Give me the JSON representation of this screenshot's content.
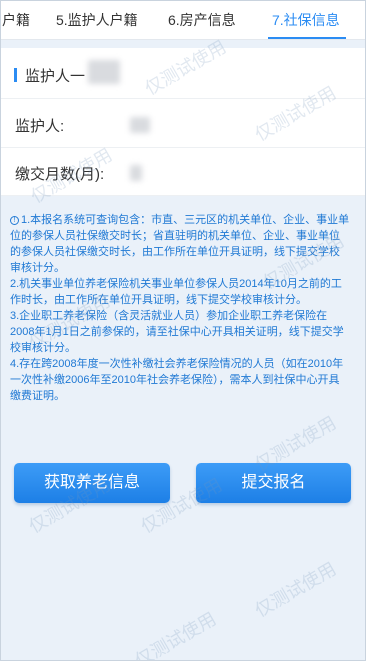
{
  "tabs": [
    {
      "label": "户籍"
    },
    {
      "label": "5.监护人户籍"
    },
    {
      "label": "6.房产信息"
    },
    {
      "label": "7.社保信息",
      "active": true
    }
  ],
  "section": {
    "title": "监护人一"
  },
  "fields": [
    {
      "label": "监护人:"
    },
    {
      "label": "缴交月数(月):"
    }
  ],
  "notice": {
    "icon": "info-icon",
    "paragraphs": [
      "1.本报名系统可查询包含：市直、三元区的机关单位、企业、事业单位的参保人员社保缴交时长；省直驻明的机关单位、企业、事业单位的参保人员社保缴交时长，由工作所在单位开具证明，线下提交学校审核计分。",
      "2.机关事业单位养老保险机关事业单位参保人员2014年10月之前的工作时长，由工作所在单位开具证明，线下提交学校审核计分。",
      "3.企业职工养老保险（含灵活就业人员）参加企业职工养老保险在2008年1月1日之前参保的，请至社保中心开具相关证明，线下提交学校审核计分。",
      "4.存在跨2008年度一次性补缴社会养老保险情况的人员（如在2010年一次性补缴2006年至2010年社会养老保险），需本人到社保中心开具缴费证明。"
    ]
  },
  "buttons": {
    "fetch": "获取养老信息",
    "submit": "提交报名"
  },
  "watermark": "仅测试使用",
  "colors": {
    "accent": "#2b8cf3",
    "notice_text": "#2079d4",
    "background": "#eaf1f9"
  }
}
